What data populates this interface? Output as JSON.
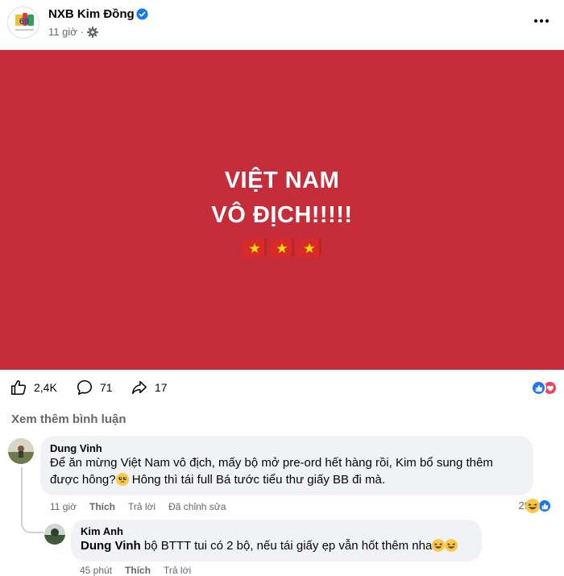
{
  "post": {
    "page_name": "NXB Kim Đồng",
    "time": "11 giờ",
    "separator": "·",
    "banner": {
      "line1": "VIỆT NAM",
      "line2": "VÔ ĐỊCH!!!!!",
      "flags": [
        "vietnam-flag",
        "vietnam-flag",
        "vietnam-flag"
      ],
      "background": "#c52d3b"
    },
    "stats": {
      "likes": "2,4K",
      "comments": "71",
      "shares": "17"
    }
  },
  "comments": {
    "view_more": "Xem thêm bình luận",
    "items": [
      {
        "author": "Dung Vinh",
        "line1": "Để ăn mừng Việt Nam vô địch, mấy bộ mở pre-ord hết hàng rồi, Kim bổ sung thêm",
        "line2_a": "được hông?",
        "line2_b": " Hông thì tái full Bá tước tiểu thư giấy BB đi mà.",
        "time": "11 giờ",
        "like": "Thích",
        "reply": "Trả lời",
        "edited": "Đã chỉnh sửa",
        "reaction_count": "29"
      },
      {
        "author": "Kim Anh",
        "mention": "Dung Vinh",
        "text": " bộ BTTT tui có 2 bộ, nếu tái giấy ẹp vẫn hốt thêm nha",
        "time": "45 phút",
        "like": "Thích",
        "reply": "Trả lời"
      }
    ]
  },
  "colors": {
    "accent": "#1877f2",
    "secondary_text": "#65676b",
    "bubble": "#f0f2f5"
  }
}
